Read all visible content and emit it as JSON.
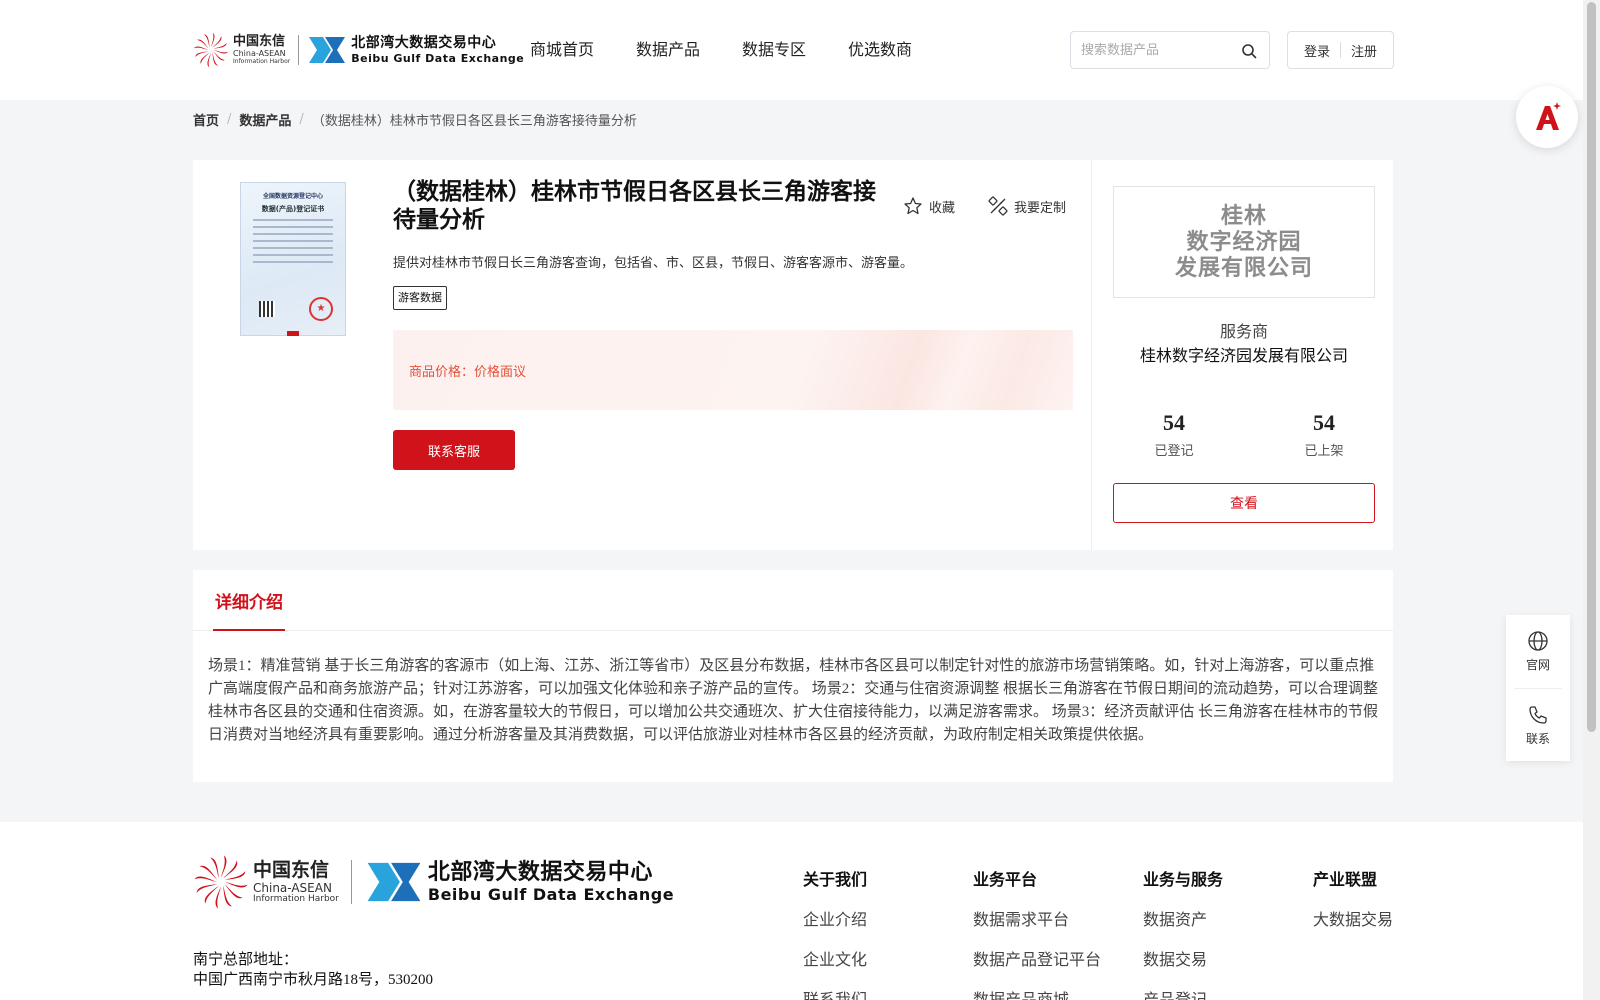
{
  "brand": {
    "cn_name": "中国东信",
    "en_name": "China-ASEAN",
    "en_sub": "Information Harbor",
    "exchange_cn": "北部湾大数据交易中心",
    "exchange_en": "Beibu Gulf Data Exchange",
    "accent_color": "#d0121b"
  },
  "nav": {
    "items": [
      "商城首页",
      "数据产品",
      "数据专区",
      "优选数商"
    ]
  },
  "search": {
    "placeholder": "搜索数据产品",
    "value": "",
    "icon": "search-icon"
  },
  "auth": {
    "login": "登录",
    "register": "注册"
  },
  "breadcrumb": {
    "home": "首页",
    "category": "数据产品",
    "current": "（数据桂林）桂林市节假日各区县长三角游客接待量分析"
  },
  "product": {
    "title": "（数据桂林）桂林市节假日各区县长三角游客接待量分析",
    "favorite_label": "收藏",
    "custom_label": "我要定制",
    "description": "提供对桂林市节假日长三角游客查询，包括省、市、区县，节假日、游客客源市、游客量。",
    "tag": "游客数据",
    "price_label": "商品价格：",
    "price_value": "价格面议",
    "contact_button": "联系客服",
    "thumbnail": {
      "cert_header": "全国数据资源登记中心",
      "cert_title": "数据(产品)登记证书"
    }
  },
  "vendor": {
    "logo_text_lines": [
      "桂林",
      "数字经济园",
      "发展有限公司"
    ],
    "role": "服务商",
    "name": "桂林数字经济园发展有限公司",
    "registered_count": "54",
    "registered_label": "已登记",
    "listed_count": "54",
    "listed_label": "已上架",
    "view_button": "查看"
  },
  "detail": {
    "tab_label": "详细介绍",
    "body": "场景1：精准营销 基于长三角游客的客源市（如上海、江苏、浙江等省市）及区县分布数据，桂林市各区县可以制定针对性的旅游市场营销策略。如，针对上海游客，可以重点推广高端度假产品和商务旅游产品；针对江苏游客，可以加强文化体验和亲子游产品的宣传。 场景2：交通与住宿资源调整 根据长三角游客在节假日期间的流动趋势，可以合理调整桂林市各区县的交通和住宿资源。如，在游客量较大的节假日，可以增加公共交通班次、扩大住宿接待能力，以满足游客需求。 场景3：经济贡献评估 长三角游客在桂林市的节假日消费对当地经济具有重要影响。通过分析游客量及其消费数据，可以评估旅游业对桂林市各区县的经济贡献，为政府制定相关政策提供依据。"
  },
  "side_float": {
    "website_label": "官网",
    "contact_label": "联系"
  },
  "footer": {
    "address_title": "南宁总部地址：",
    "address": "中国广西南宁市秋月路18号，530200",
    "columns": [
      {
        "heading": "关于我们",
        "items": [
          "企业介绍",
          "企业文化",
          "联系我们"
        ]
      },
      {
        "heading": "业务平台",
        "items": [
          "数据需求平台",
          "数据产品登记平台",
          "数据产品商城"
        ]
      },
      {
        "heading": "业务与服务",
        "items": [
          "数据资产",
          "数据交易",
          "产品登记"
        ]
      },
      {
        "heading": "产业联盟",
        "items": [
          "大数据交易"
        ]
      }
    ]
  }
}
